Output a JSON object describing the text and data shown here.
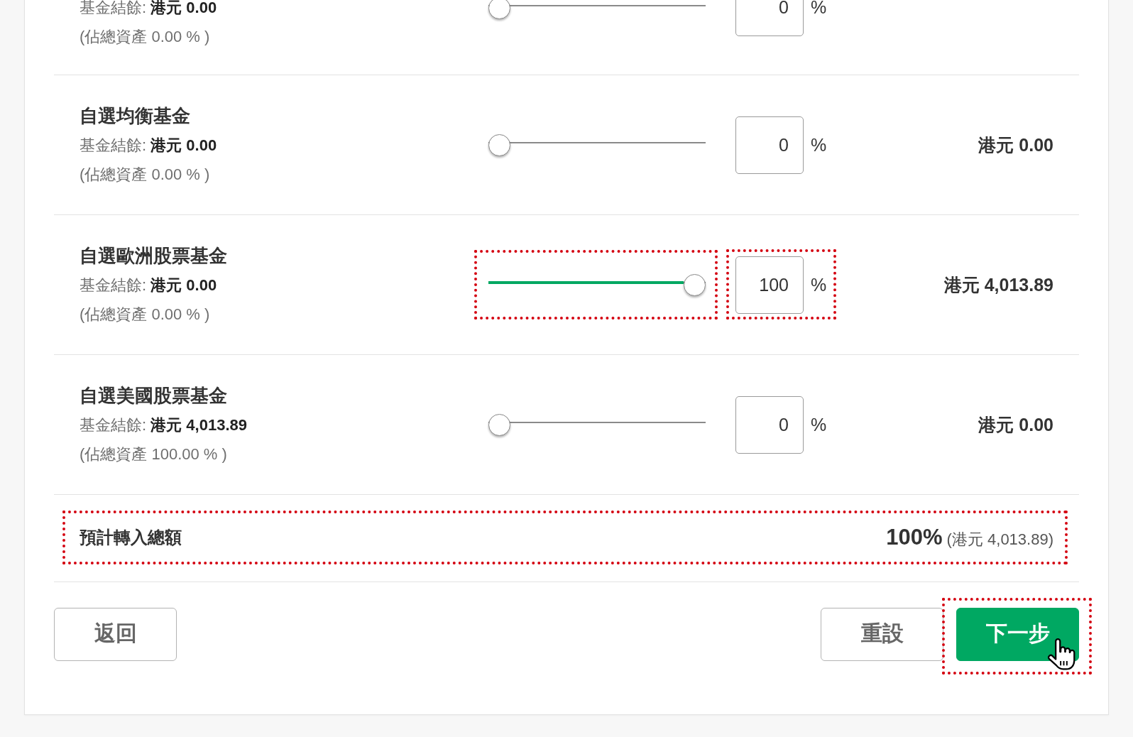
{
  "funds": [
    {
      "balance": "基金結餘: **港元 0.00**",
      "share": "(佔總資產 0.00 % )",
      "level": 0,
      "percent": "0",
      "unit": "%",
      "highlighted": false
    },
    {
      "name": "自選均衡基金",
      "balance": "基金結餘: **港元 0.00**",
      "share": "(佔總資產 0.00 % )",
      "level": 0,
      "percent": "0",
      "unit": "%",
      "amount": "港元 0.00",
      "highlighted": false
    },
    {
      "name": "自選歐洲股票基金",
      "balance": "基金結餘: **港元 0.00**",
      "share": "(佔總資產 0.00 % )",
      "level": 1,
      "percent": "100",
      "unit": "%",
      "amount": "港元 4,013.89",
      "highlighted": true
    },
    {
      "name": "自選美國股票基金",
      "balance": "基金結餘: **港元 4,013.89**",
      "share": "(佔總資產 100.00 % )",
      "level": 0,
      "percent": "0",
      "unit": "%",
      "amount": "港元 0.00",
      "highlighted": false
    }
  ],
  "total": {
    "label": "預計轉入總額",
    "value": "**100%** (港元 4,013.89)",
    "highlighted": true
  },
  "footer": {
    "left_buttons": [
      {
        "label": "返回",
        "kind": "secondary",
        "highlighted": false,
        "hovered": false
      }
    ],
    "right_buttons": [
      {
        "label": "重設",
        "kind": "secondary",
        "highlighted": false,
        "hovered": false
      },
      {
        "label": "下一步",
        "kind": "primary",
        "highlighted": true,
        "hovered": true
      }
    ]
  }
}
